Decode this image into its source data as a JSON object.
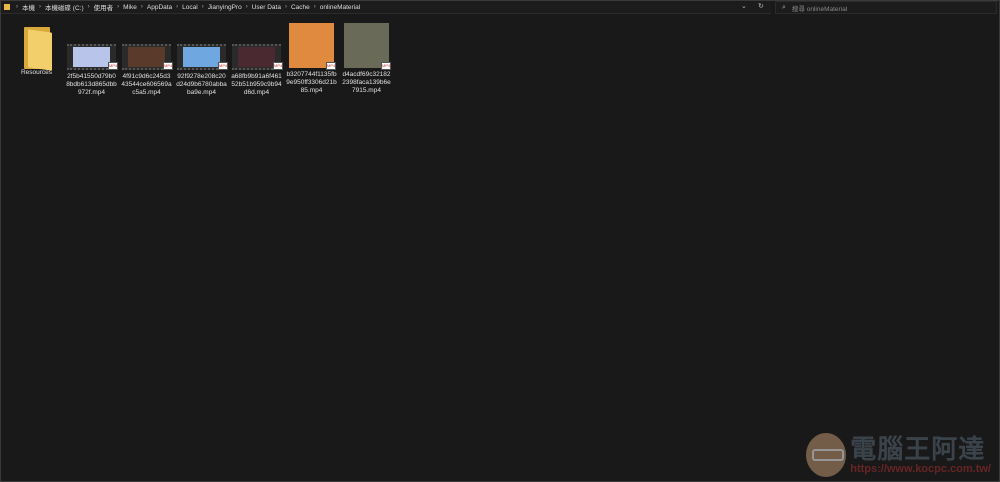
{
  "breadcrumb": [
    "本機",
    "本機磁碟 (C:)",
    "使用者",
    "Mike",
    "AppData",
    "Local",
    "JianyingPro",
    "User Data",
    "Cache",
    "onlineMaterial"
  ],
  "search": {
    "placeholder": "搜尋 onlineMaterial"
  },
  "items": [
    {
      "name": "Resources",
      "type": "folder"
    },
    {
      "name": "2f5b41550d79b08bdb613d865dbb972f.mp4",
      "type": "video",
      "thumb": "#b8c4ea"
    },
    {
      "name": "4f91c9d6c245d343544ce606569ac5a5.mp4",
      "type": "video",
      "thumb": "#5a3a2a"
    },
    {
      "name": "92f9278e208c20d24d9b6780abbaba9e.mp4",
      "type": "video",
      "thumb": "#6fa8e0"
    },
    {
      "name": "a68fb9b91a6f46152b51b959c9b94d6d.mp4",
      "type": "video",
      "thumb": "#4a2a30"
    },
    {
      "name": "b3207744f1135fb9e950ff3306d21b85.mp4",
      "type": "video-tall",
      "thumb": "#e08a40"
    },
    {
      "name": "d4acdf69c321822398faca139b6e7915.mp4",
      "type": "video-tall",
      "thumb": "#6a6a58"
    }
  ],
  "badge_text": "MP4",
  "watermark": {
    "title": "電腦王阿達",
    "url": "https://www.kocpc.com.tw/"
  }
}
